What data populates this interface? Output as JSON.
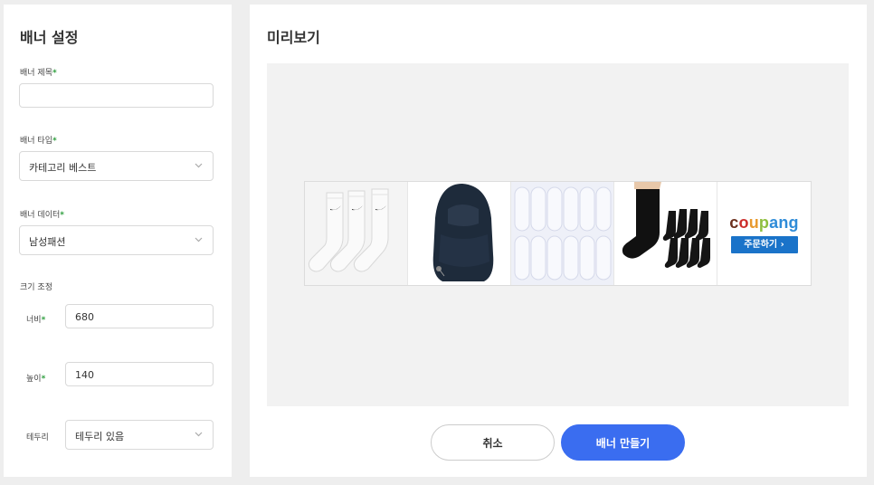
{
  "settings": {
    "title": "배너 설정",
    "banner_title_label": "배너 제목",
    "banner_title_value": "",
    "banner_type_label": "배너 타입",
    "banner_type_value": "카테고리 베스트",
    "banner_data_label": "배너 데이터",
    "banner_data_value": "남성패션",
    "size_label": "크기 조정",
    "width_label": "너비",
    "width_value": "680",
    "height_label": "높이",
    "height_value": "140",
    "border_label": "테두리",
    "border_value": "테두리 있음",
    "required_mark": "*"
  },
  "preview": {
    "title": "미리보기",
    "products": [
      "white-crew-socks",
      "navy-fleece-balaclava",
      "white-no-show-socks",
      "black-crew-socks-set"
    ],
    "brand": {
      "logo_parts": [
        "c",
        "o",
        "u",
        "p",
        "ang"
      ],
      "button_label": "주문하기 ›"
    }
  },
  "actions": {
    "cancel_label": "취소",
    "create_label": "배너 만들기"
  },
  "colors": {
    "required": "#2e9e3e",
    "primary_button": "#3a6df0",
    "brand_button": "#1a73c9"
  }
}
